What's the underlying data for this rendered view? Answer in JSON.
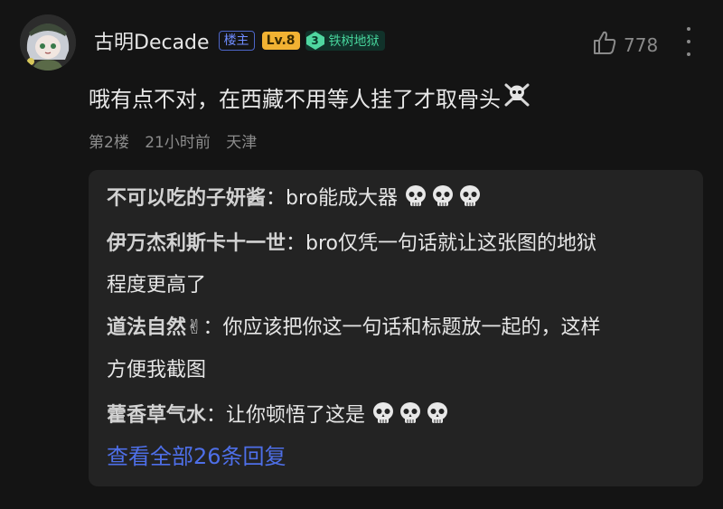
{
  "author": {
    "name": "古明Decade",
    "op_badge": "楼主",
    "level_badge": "Lv.8",
    "title_badge_level": "3",
    "title_badge_text": "铁树地狱"
  },
  "likes": "778",
  "post_text": "哦有点不对，在西藏不用等人挂了才取骨头",
  "meta": {
    "floor": "第2楼",
    "time": "21小时前",
    "location": "天津"
  },
  "replies": [
    {
      "name": "不可以吃的子妍酱",
      "sep": "：",
      "text": "bro能成大器"
    },
    {
      "name": "伊万杰利斯卡十一世",
      "sep": "：",
      "text": "bro仅凭一句话就让这张图的地狱"
    },
    {
      "continuation": "程度更高了"
    },
    {
      "name": "道法自然✌",
      "sep": "：",
      "text": "你应该把你这一句话和标题放一起的，这样"
    },
    {
      "continuation": "方便我截图"
    },
    {
      "name": "藿香草气水",
      "sep": "：",
      "text": "让你顿悟了这是"
    }
  ],
  "view_all": "查看全部26条回复",
  "colors": {
    "background": "#141414",
    "reply_panel": "#232323",
    "link": "#4e6fe8",
    "level_badge": "#f2b233",
    "title_badge": "#46d39a"
  }
}
